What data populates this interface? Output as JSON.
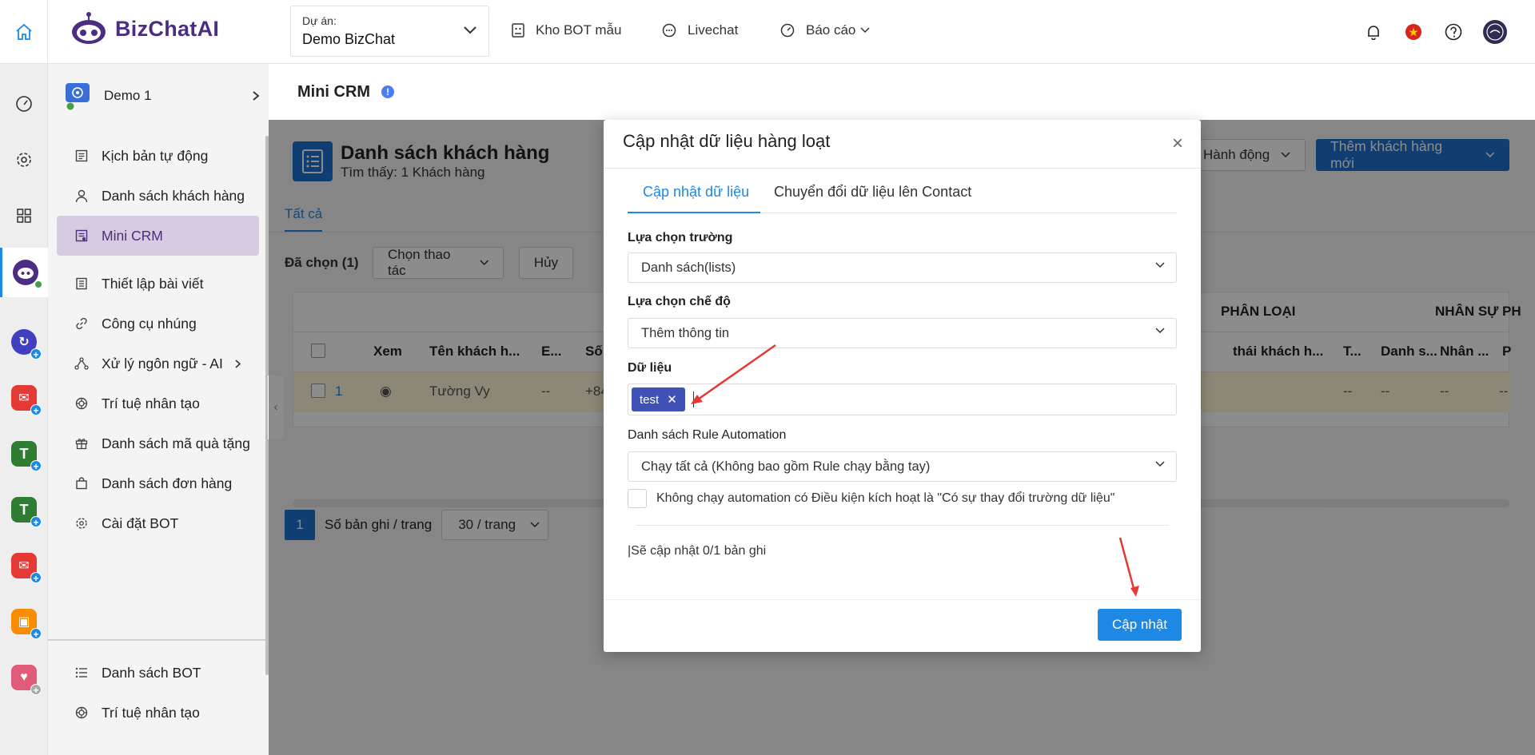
{
  "header": {
    "brand": "BizChatAI",
    "project_label": "Dự án:",
    "project_value": "Demo BizChat",
    "nav": [
      "Kho BOT mẫu",
      "Livechat",
      "Báo cáo"
    ]
  },
  "sidebar": {
    "bot_name": "Demo 1",
    "items": [
      {
        "label": "Kịch bản tự động",
        "icon": "script-icon"
      },
      {
        "label": "Danh sách khách hàng",
        "icon": "user-icon"
      },
      {
        "label": "Mini CRM",
        "icon": "crm-icon",
        "active": true
      },
      {
        "label": "Thiết lập bài viết",
        "icon": "post-icon"
      },
      {
        "label": "Công cụ nhúng",
        "icon": "link-icon"
      },
      {
        "label": "Xử lý ngôn ngữ - AI",
        "icon": "nlp-icon"
      },
      {
        "label": "Trí tuệ nhân tạo",
        "icon": "ai-icon"
      },
      {
        "label": "Danh sách mã quà tặng",
        "icon": "gift-icon"
      },
      {
        "label": "Danh sách đơn hàng",
        "icon": "bag-icon"
      },
      {
        "label": "Cài đặt BOT",
        "icon": "gear-icon"
      }
    ],
    "bottom_items": [
      {
        "label": "Danh sách BOT",
        "icon": "list-icon"
      },
      {
        "label": "Trí tuệ nhân tạo",
        "icon": "ai-icon"
      }
    ]
  },
  "main": {
    "page_title": "Mini CRM",
    "list_title": "Danh sách khách hàng",
    "list_sub": "Tìm thấy: 1 Khách hàng",
    "actions_label": "Hành động",
    "add_label": "Thêm khách hàng mới",
    "tab_all": "Tất cả",
    "selected_label": "Đã chọn (1)",
    "choose_action": "Chọn thao tác",
    "cancel": "Hủy",
    "group_headers": [
      "PHÂN LOẠI",
      "NHÂN SỰ PH"
    ],
    "columns": [
      "Xem",
      "Tên khách h...",
      "E...",
      "Số",
      "thái khách h...",
      "T...",
      "Danh s...",
      "Nhân ...",
      "P"
    ],
    "row": {
      "index": "1",
      "name": "Tường Vy",
      "email": "--",
      "phone": "+84",
      "c1": "--",
      "c2": "--",
      "c3": "--",
      "c4": "--"
    },
    "pager": {
      "page": "1",
      "per_page_label": "Số bản ghi / trang",
      "per_page": "30 / trang"
    }
  },
  "modal": {
    "title": "Cập nhật dữ liệu hàng loạt",
    "tabs": [
      "Cập nhật dữ liệu",
      "Chuyển đổi dữ liệu lên Contact"
    ],
    "field_label": "Lựa chọn trường",
    "field_value": "Danh sách(lists)",
    "mode_label": "Lựa chọn chế độ",
    "mode_value": "Thêm thông tin",
    "data_label": "Dữ liệu",
    "tag": "test",
    "rule_label": "Danh sách Rule Automation",
    "rule_value": "Chạy tất cả (Không bao gồm Rule chạy bằng tay)",
    "checkbox_label": "Không chạy automation có Điều kiện kích hoạt là \"Có sự thay đổi trường dữ liệu\"",
    "note": "|Sẽ cập nhật 0/1 bản ghi",
    "submit": "Cập nhật"
  },
  "colors": {
    "primary": "#1e88e5",
    "brand": "#4b2e83",
    "tag": "#3f51b5",
    "annotation": "#e53935"
  }
}
